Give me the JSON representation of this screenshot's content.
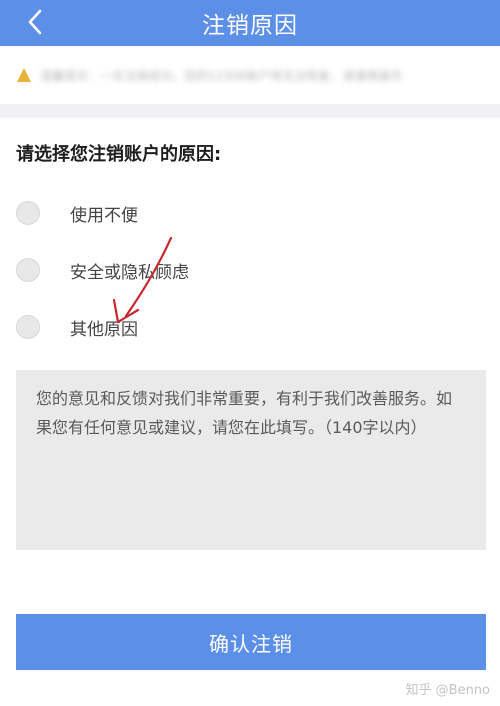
{
  "header": {
    "title": "注销原因",
    "back_icon": "chevron-left-icon",
    "background": "#5b8fe8"
  },
  "notice": {
    "icon": "warning-icon",
    "text": "温馨提示：一旦注销成功，您的12306账户将无法恢复，请谨慎操作"
  },
  "form": {
    "question": "请选择您注销账户的原因:",
    "options": [
      {
        "label": "使用不便"
      },
      {
        "label": "安全或隐私顾虑"
      },
      {
        "label": "其他原因"
      }
    ],
    "feedback_placeholder": "您的意见和反馈对我们非常重要，有利于我们改善服务。如果您有任何意见或建议，请您在此填写。（140字以内）"
  },
  "confirm": {
    "label": "确认注销"
  },
  "watermark": "知乎 @Benno",
  "annotation": {
    "icon": "arrow-icon",
    "color": "#c8282d"
  }
}
